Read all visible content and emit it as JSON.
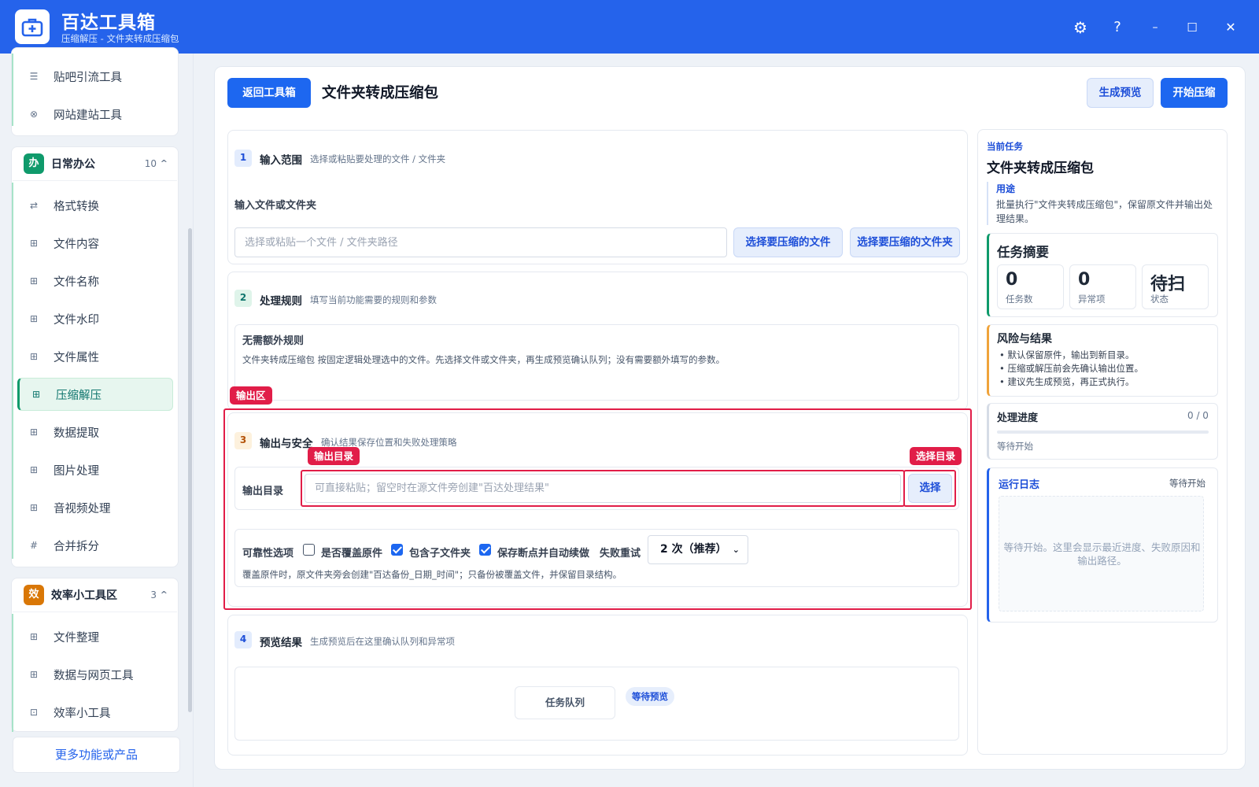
{
  "app": {
    "title": "百达工具箱",
    "subtitle": "压缩解压 - 文件夹转成压缩包"
  },
  "window_controls": {
    "settings": "⚙",
    "help": "?",
    "minimize": "–",
    "maximize": "☐",
    "close": "✕"
  },
  "sidebar": {
    "top_items": [
      {
        "label": "贴吧引流工具",
        "icon": "☰"
      },
      {
        "label": "网站建站工具",
        "icon": "⊗"
      }
    ],
    "groups": [
      {
        "badge": "办",
        "badge_color": "#0f9a6b",
        "title": "日常办公",
        "count": "10",
        "caret": "^",
        "items": [
          {
            "label": "格式转换",
            "icon": "⇄"
          },
          {
            "label": "文件内容",
            "icon": "⊞"
          },
          {
            "label": "文件名称",
            "icon": "⊞"
          },
          {
            "label": "文件水印",
            "icon": "⊞"
          },
          {
            "label": "文件属性",
            "icon": "⊞"
          },
          {
            "label": "压缩解压",
            "icon": "⊞"
          },
          {
            "label": "数据提取",
            "icon": "⊞"
          },
          {
            "label": "图片处理",
            "icon": "⊞"
          },
          {
            "label": "音视频处理",
            "icon": "⊞"
          },
          {
            "label": "合并拆分",
            "icon": "#"
          }
        ]
      },
      {
        "badge": "效",
        "badge_color": "#d97706",
        "title": "效率小工具区",
        "count": "3",
        "caret": "^",
        "items": [
          {
            "label": "文件整理",
            "icon": "⊞"
          },
          {
            "label": "数据与网页工具",
            "icon": "⊞"
          },
          {
            "label": "效率小工具",
            "icon": "⊡"
          }
        ]
      }
    ],
    "more_label": "更多功能或产品"
  },
  "header": {
    "back_button": "返回工具箱",
    "title": "文件夹转成压缩包",
    "preview_button": "生成预览",
    "start_button": "开始压缩"
  },
  "section1": {
    "num": "1",
    "title": "输入范围",
    "desc": "选择或粘贴要处理的文件 / 文件夹",
    "field_label": "输入文件或文件夹",
    "input_placeholder": "选择或粘贴一个文件 / 文件夹路径",
    "input_value": "",
    "select_files_button": "选择要压缩的文件",
    "select_folder_button": "选择要压缩的文件夹"
  },
  "section2": {
    "num": "2",
    "title": "处理规则",
    "desc": "填写当前功能需要的规则和参数",
    "box_title": "无需额外规则",
    "box_desc": "文件夹转成压缩包 按固定逻辑处理选中的文件。先选择文件或文件夹，再生成预览确认队列；没有需要额外填写的参数。"
  },
  "section3": {
    "num": "3",
    "title": "输出与安全",
    "desc": "确认结果保存位置和失败处理策略",
    "output_area_tag": "输出区",
    "output_dir_tag": "输出目录",
    "choose_dir_tag": "选择目录",
    "output_label": "输出目录",
    "output_placeholder": "可直接粘贴；留空时在源文件旁创建\"百达处理结果\"",
    "output_value": "",
    "choose_button": "选择",
    "reliability_label": "可靠性选项",
    "options": [
      {
        "label": "是否覆盖原件",
        "checked": false
      },
      {
        "label": "包含子文件夹",
        "checked": true
      },
      {
        "label": "保存断点并自动续做",
        "checked": true
      }
    ],
    "retry_label": "失败重试",
    "retry_value": "2 次（推荐）",
    "note": "覆盖原件时，原文件夹旁会创建\"百达备份_日期_时间\"；只备份被覆盖文件，并保留目录结构。"
  },
  "section4": {
    "num": "4",
    "title": "预览结果",
    "desc": "生成预览后在这里确认队列和异常项",
    "queue_button": "任务队列",
    "status_badge": "等待预览"
  },
  "right": {
    "current_task_label": "当前任务",
    "task_title": "文件夹转成压缩包",
    "purpose_label": "用途",
    "purpose_text": "批量执行\"文件夹转成压缩包\"，保留原文件并输出处理结果。",
    "summary_title": "任务摘要",
    "stats": [
      {
        "value": "0",
        "label": "任务数"
      },
      {
        "value": "0",
        "label": "异常项"
      },
      {
        "value": "待扫",
        "label": "状态"
      }
    ],
    "risk_title": "风险与结果",
    "risks": [
      "默认保留原件，输出到新目录。",
      "压缩或解压前会先确认输出位置。",
      "建议先生成预览，再正式执行。"
    ],
    "progress_title": "处理进度",
    "progress_count": "0 / 0",
    "progress_value": 0,
    "progress_status": "等待开始",
    "log_title": "运行日志",
    "log_status": "等待开始",
    "log_placeholder": "等待开始。这里会显示最近进度、失败原因和输出路径。"
  },
  "colors": {
    "brand": "#2563eb",
    "accent_green": "#0f9a6b",
    "highlight_red": "#e11d48",
    "amber": "#d97706"
  }
}
